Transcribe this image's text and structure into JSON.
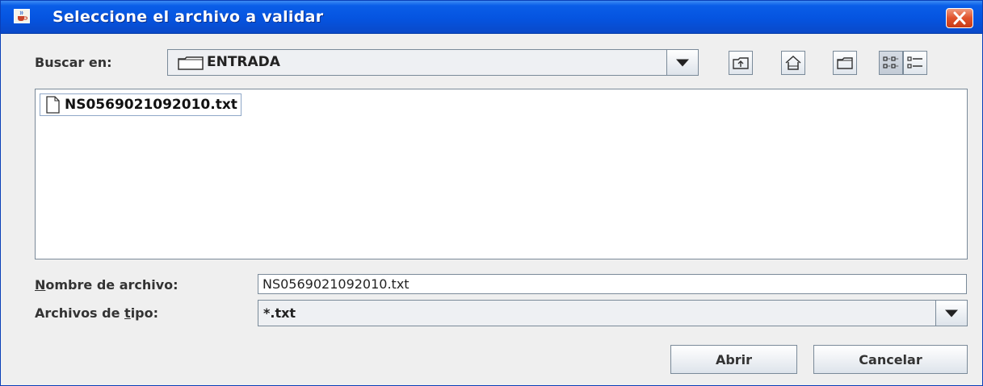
{
  "window": {
    "title": "Seleccione el archivo a validar",
    "icon": "java-cup-icon",
    "close_icon": "close-icon"
  },
  "toolbar": {
    "look_in_label": "Buscar en:",
    "look_in_value": "ENTRADA",
    "buttons": [
      {
        "name": "up-one-level-icon"
      },
      {
        "name": "home-icon"
      },
      {
        "name": "new-folder-icon"
      },
      {
        "name": "list-view-icon",
        "selected": true
      },
      {
        "name": "details-view-icon",
        "selected": false
      }
    ]
  },
  "file_list": {
    "items": [
      {
        "name": "NS0569021092010.txt",
        "icon": "file-icon",
        "selected": true
      }
    ]
  },
  "filename": {
    "label_first": "N",
    "label_rest": "ombre de archivo:",
    "value": "NS0569021092010.txt"
  },
  "filetype": {
    "label_before": "Archivos de ",
    "label_underlined": "t",
    "label_after": "ipo:",
    "value": "*.txt"
  },
  "actions": {
    "open": "Abrir",
    "cancel": "Cancelar"
  },
  "colors": {
    "titlebar": "#0554e0",
    "close_button": "#e0522c",
    "panel": "#efefef"
  }
}
